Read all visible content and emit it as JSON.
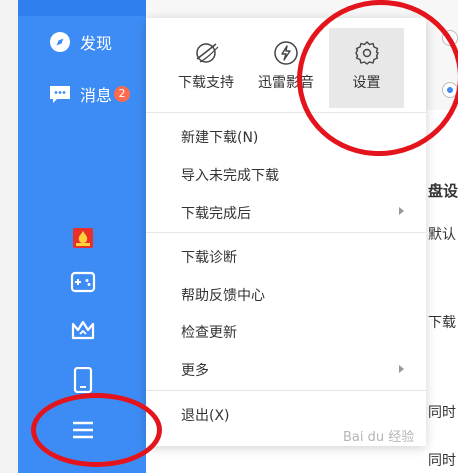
{
  "sidebar": {
    "discover_label": "发现",
    "messages_label": "消息",
    "messages_badge": "2",
    "icons": [
      "gift-icon",
      "gamepad-icon",
      "crown-icon",
      "phone-icon",
      "menu-icon"
    ]
  },
  "menu": {
    "tools": [
      {
        "label": "下载支持",
        "icon": "download-support-icon"
      },
      {
        "label": "迅雷影音",
        "icon": "xunlei-player-icon"
      },
      {
        "label": "设置",
        "icon": "gear-icon"
      }
    ],
    "items": [
      {
        "label": "新建下载(N)"
      },
      {
        "label": "导入未完成下载"
      },
      {
        "label": "下载完成后",
        "submenu": true
      },
      {
        "label": "下载诊断"
      },
      {
        "label": "帮助反馈中心"
      },
      {
        "label": "检查更新"
      },
      {
        "label": "更多",
        "submenu": true
      },
      {
        "label": "退出(X)"
      }
    ]
  },
  "background": {
    "texts": [
      "盘设",
      "默认",
      "下载",
      "同时",
      "同时"
    ]
  },
  "watermark": "Bai du 经验",
  "colors": {
    "sidebar_blue": "#3d8cf5",
    "badge": "#ff6a4d",
    "annotation_red": "#e4141c"
  }
}
